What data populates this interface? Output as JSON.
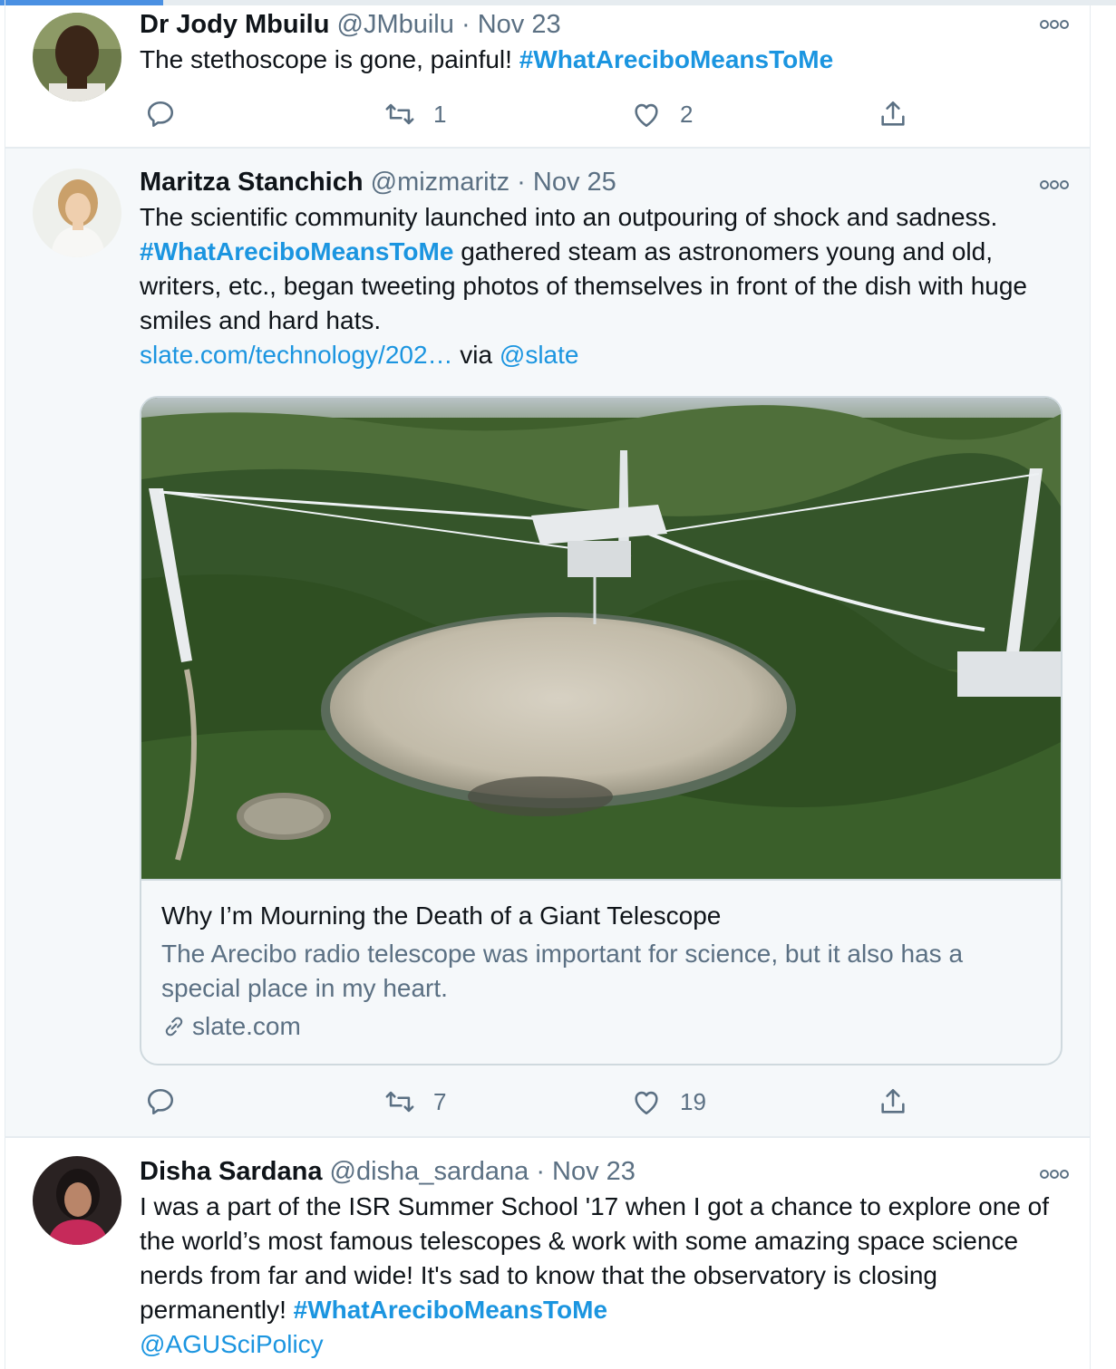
{
  "tweets": [
    {
      "name": "Dr Jody Mbuilu",
      "handle": "@JMbuilu",
      "sep": "·",
      "date": "Nov 23",
      "text_plain": "The stethoscope is gone, painful! ",
      "hashtag": "#WhatAreciboMeansToMe",
      "replies": "",
      "retweets": "1",
      "likes": "2"
    },
    {
      "name": "Maritza Stanchich",
      "handle": "@mizmaritz",
      "sep": "·",
      "date": "Nov 25",
      "text_part1": "The scientific community launched into an outpouring of shock and sadness. ",
      "hashtag": "#WhatAreciboMeansToMe",
      "text_part2": " gathered steam as astronomers young and old, writers, etc., began tweeting photos of themselves in front of the dish with huge smiles and hard hats.",
      "link": "slate.com/technology/202…",
      "via": " via ",
      "mention": "@slate",
      "card": {
        "title": "Why I’m Mourning the Death of a Giant Telescope",
        "description": "The Arecibo radio telescope was important for science, but it also has a special place in my heart.",
        "domain": "slate.com"
      },
      "replies": "",
      "retweets": "7",
      "likes": "19"
    },
    {
      "name": "Disha Sardana",
      "handle": "@disha_sardana",
      "sep": "·",
      "date": "Nov 23",
      "text_plain": "I was a part of the ISR Summer School '17 when I got a chance to explore one of the world’s most famous telescopes & work with some amazing space science nerds from far and wide! It's sad to know that the observatory is closing permanently! ",
      "hashtag": "#WhatAreciboMeansToMe",
      "mention": "@AGUSciPolicy"
    }
  ],
  "colors": {
    "link": "#1b95e0",
    "muted": "#5b7083",
    "text": "#0f1419",
    "border": "#e6ecf0",
    "highlight_bg": "#f5f8fa"
  },
  "icons": [
    "reply-icon",
    "retweet-icon",
    "like-icon",
    "share-icon",
    "more-icon",
    "link-icon"
  ]
}
